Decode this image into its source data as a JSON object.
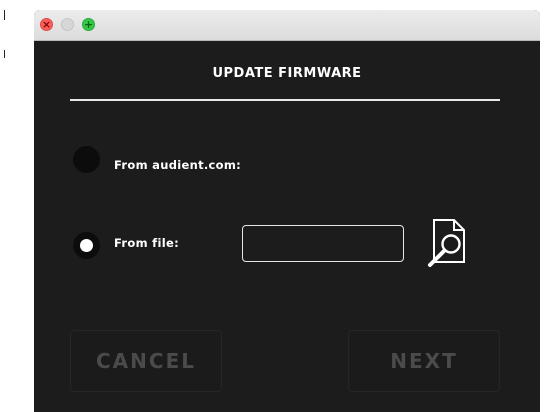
{
  "dialog": {
    "title": "UPDATE FIRMWARE",
    "options": {
      "online_label": "From audient.com:",
      "file_label": "From file:",
      "selected": "file"
    },
    "file_field": {
      "value": "",
      "placeholder": ""
    },
    "icons": {
      "browse": "browse-file-icon"
    }
  },
  "buttons": {
    "cancel": "CANCEL",
    "next": "NEXT"
  },
  "colors": {
    "window_bg": "#1c1c1c",
    "text": "#ffffff",
    "disabled_text": "#4b4b4b",
    "close": "#fc605c",
    "zoom": "#34c84a"
  }
}
